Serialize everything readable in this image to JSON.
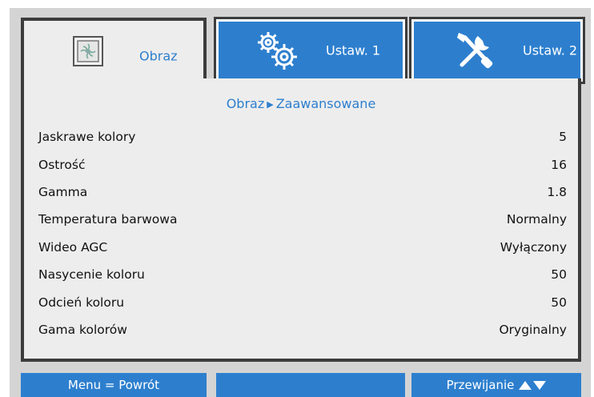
{
  "tabs": [
    {
      "label": "Obraz",
      "icon": "picture-icon",
      "active": true
    },
    {
      "label": "Ustaw. 1",
      "icon": "gears-icon",
      "active": false
    },
    {
      "label": "Ustaw. 2",
      "icon": "tools-icon",
      "active": false
    }
  ],
  "breadcrumb": {
    "parent": "Obraz",
    "current": "Zaawansowane"
  },
  "settings": [
    {
      "label": "Jaskrawe kolory",
      "value": "5"
    },
    {
      "label": "Ostrość",
      "value": "16"
    },
    {
      "label": "Gamma",
      "value": "1.8"
    },
    {
      "label": "Temperatura barwowa",
      "value": "Normalny"
    },
    {
      "label": "Wideo AGC",
      "value": "Wyłączony"
    },
    {
      "label": "Nasycenie koloru",
      "value": "50"
    },
    {
      "label": "Odcień koloru",
      "value": "50"
    },
    {
      "label": "Gama kolorów",
      "value": "Oryginalny"
    }
  ],
  "footer": {
    "left": "Menu = Powrót",
    "middle": "",
    "right": "Przewijanie"
  },
  "colors": {
    "accent": "#2d7fce",
    "panel": "#ededed",
    "frame": "#d4d4d4",
    "border": "#3c3c3c"
  }
}
